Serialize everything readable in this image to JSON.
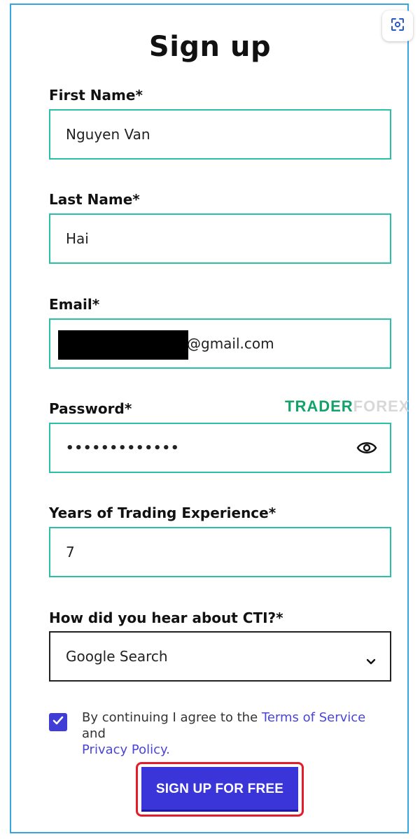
{
  "page": {
    "title": "Sign up"
  },
  "fields": {
    "first_name": {
      "label": "First Name*",
      "value": "Nguyen Van"
    },
    "last_name": {
      "label": "Last Name*",
      "value": "Hai"
    },
    "email": {
      "label": "Email*",
      "value_visible": "@gmail.com"
    },
    "password": {
      "label": "Password*",
      "value": "•••••••••••••"
    },
    "experience": {
      "label": "Years of Trading Experience*",
      "value": "7"
    },
    "source": {
      "label": "How did you hear about CTI?*",
      "selected": "Google Search"
    }
  },
  "consent": {
    "checked": true,
    "prefix": "By continuing I agree to the ",
    "terms_link": "Terms of Service",
    "middle": " and",
    "privacy_link": "Privacy Policy",
    "suffix": "."
  },
  "cta": {
    "label": "SIGN UP FOR FREE"
  },
  "watermark": {
    "part1": "TRADER",
    "part2": "FOREX"
  },
  "icons": {
    "scan": "scan-icon",
    "eye": "eye-icon",
    "chevron": "chevron-down-icon",
    "check": "check-icon"
  },
  "colors": {
    "accent": "#3a35d8",
    "field_border": "#2bc0a8",
    "frame_border": "#35a7e0",
    "highlight": "#e21c2a",
    "link": "#4a45d8"
  }
}
